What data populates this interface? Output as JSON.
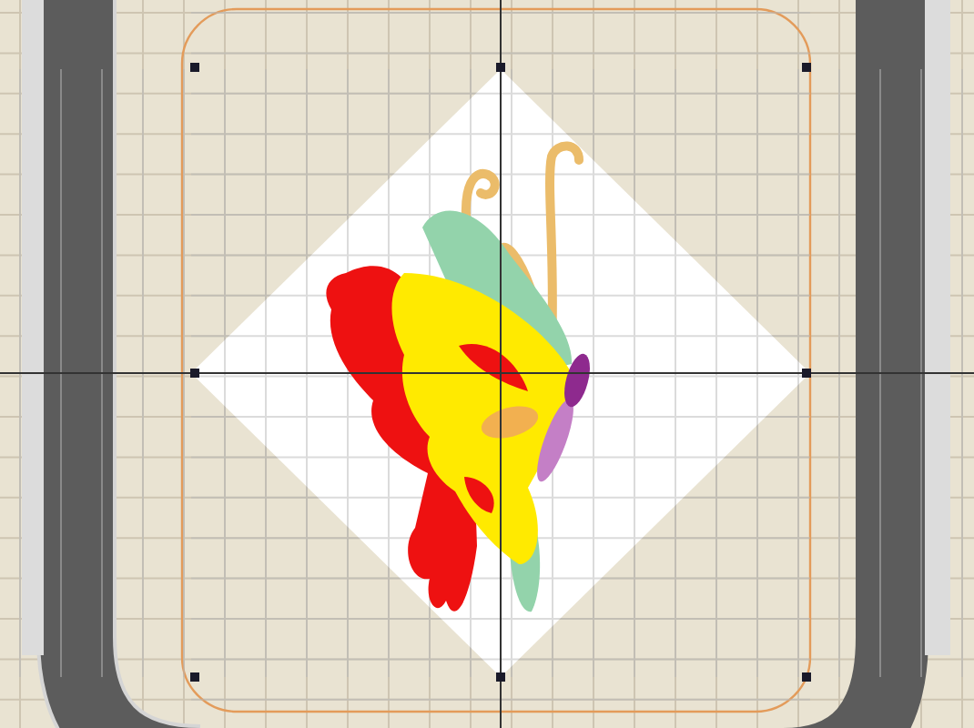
{
  "workspace": {
    "grid_visible": true,
    "design_selected": true
  }
}
